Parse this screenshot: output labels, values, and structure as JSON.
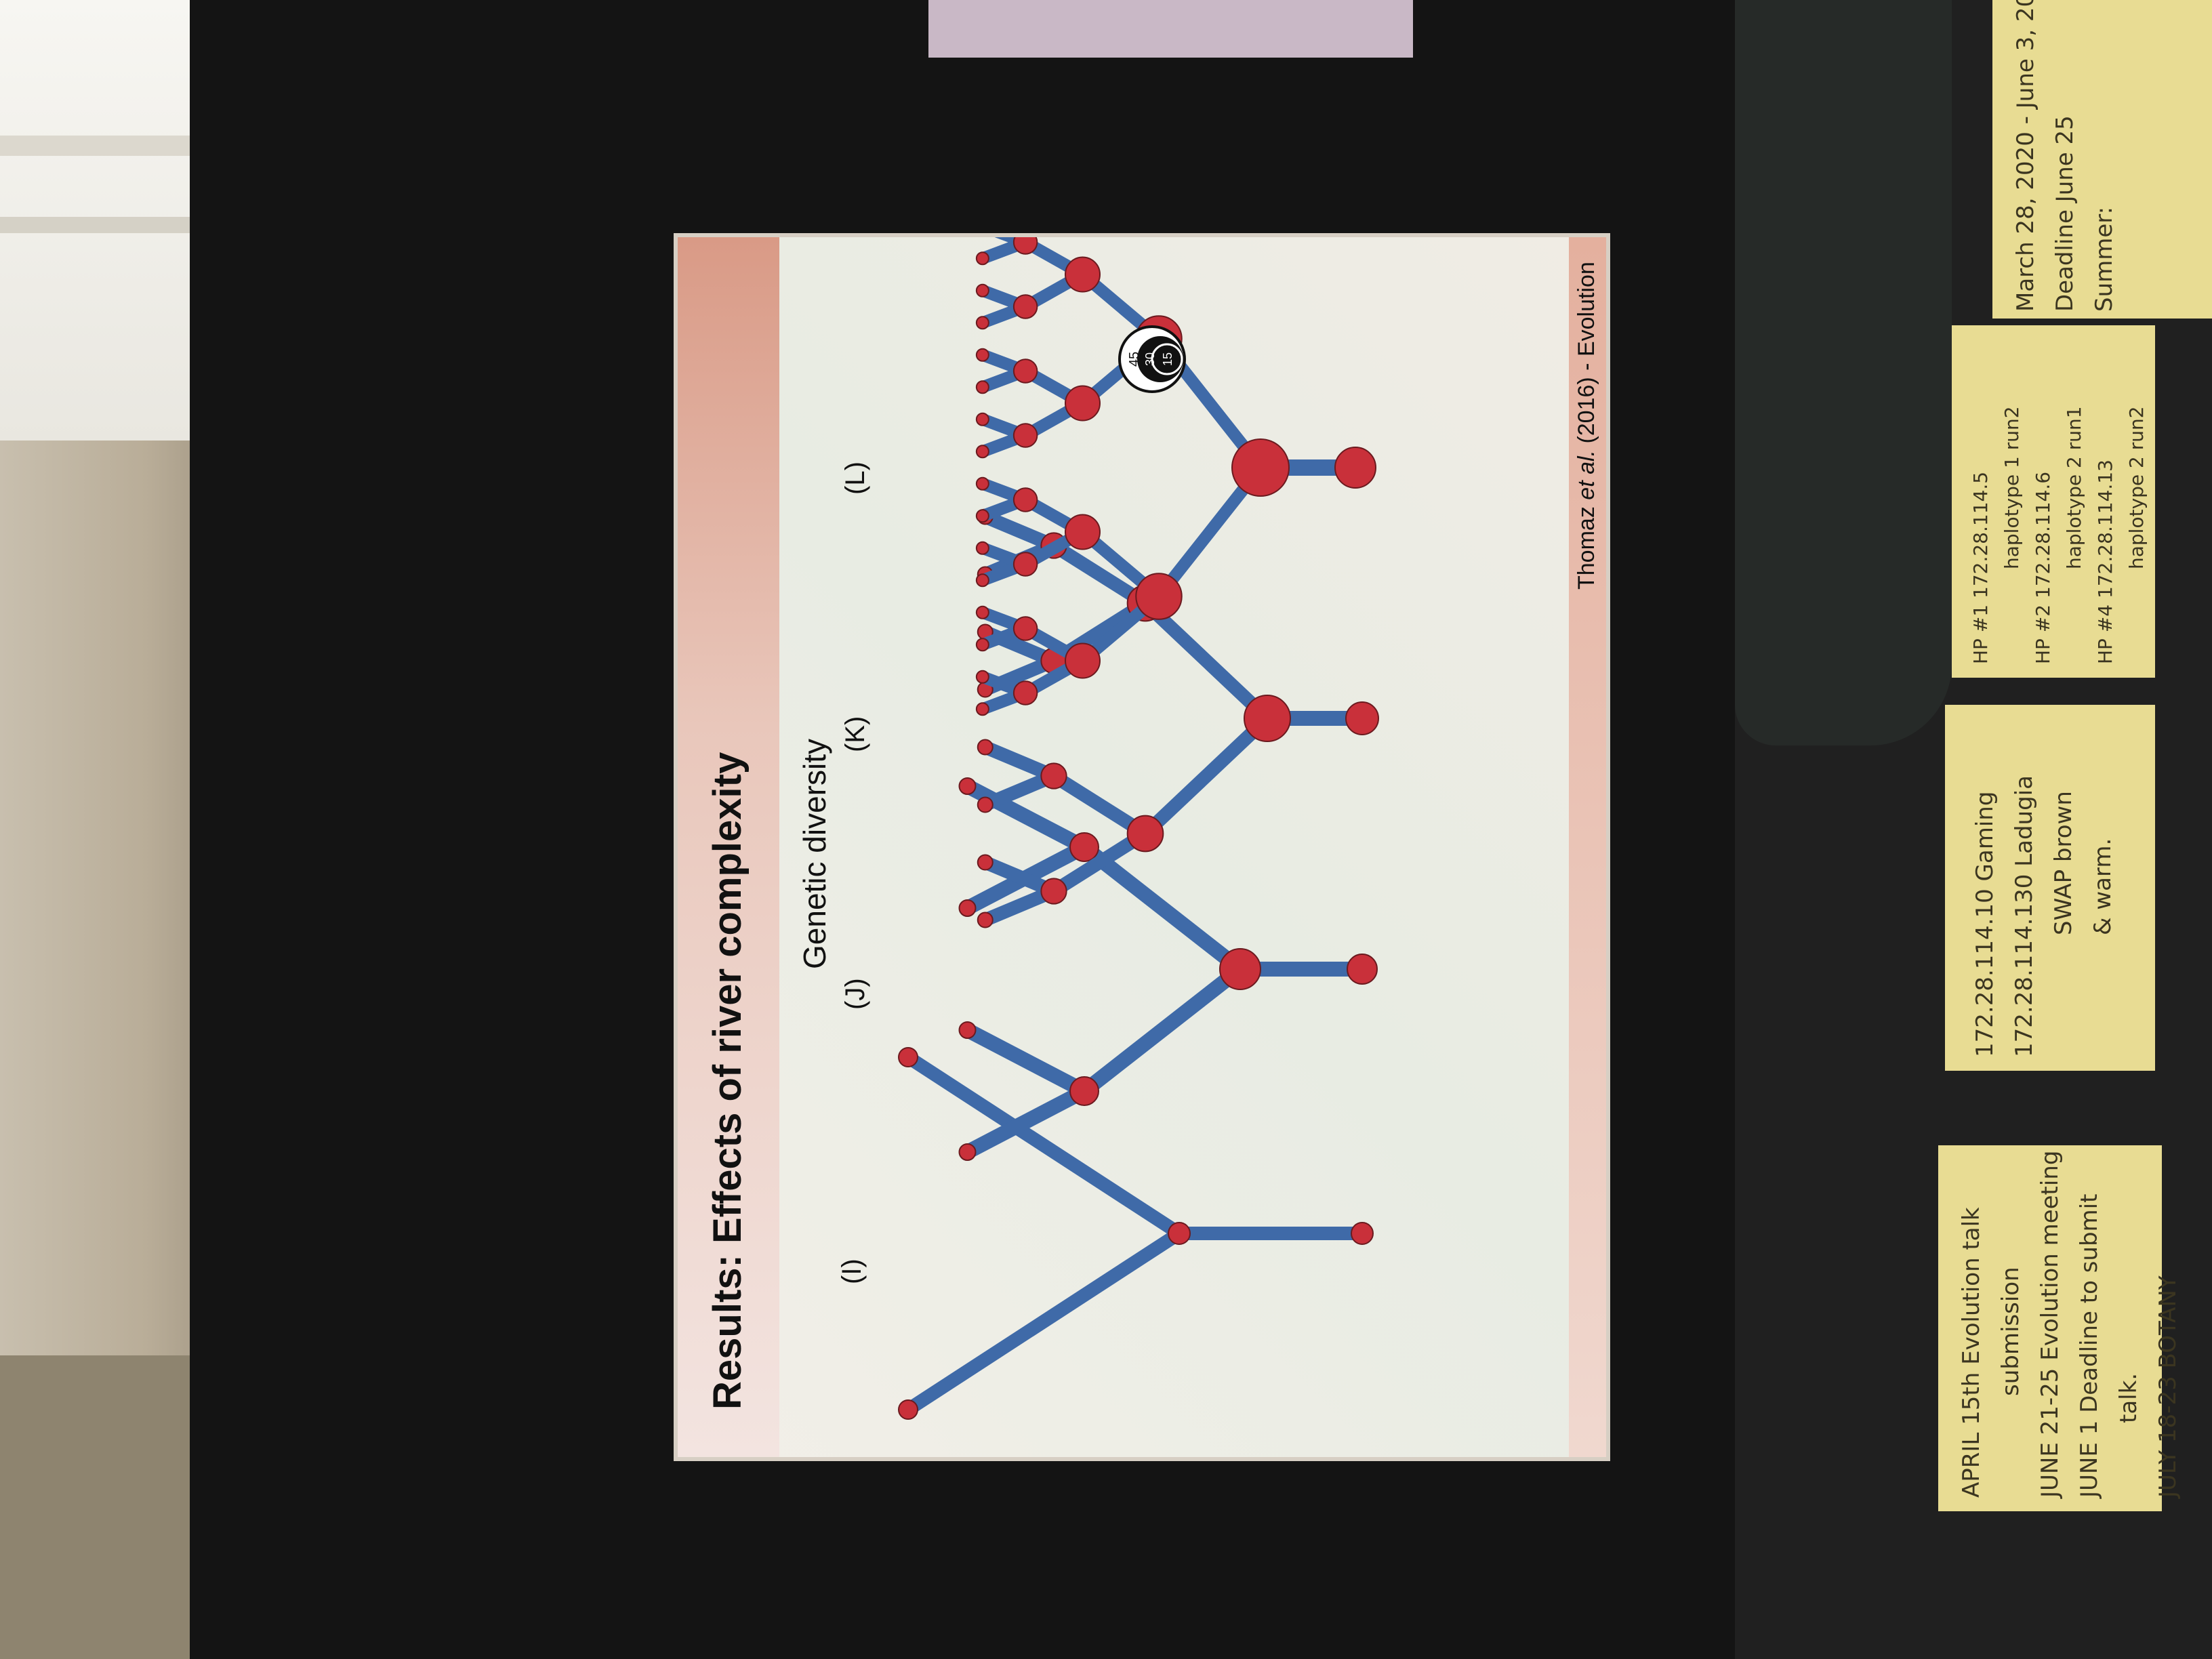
{
  "slide": {
    "title": "Results: Effects of river complexity",
    "subtitle": "Genetic diversity",
    "panels": [
      "(I)",
      "(J)",
      "(K)",
      "(L)"
    ],
    "legend_numbers": [
      "45",
      "30",
      "15"
    ],
    "citation_author": "Thomaz",
    "citation_etal": "et al.",
    "citation_rest": "(2016) - Evolution"
  },
  "notes": {
    "left": [
      "APRIL 15th  Evolution talk",
      "submission",
      "JUNE 21-25  Evolution meeting",
      "JUNE 1  Deadline to submit",
      "talk.",
      "JULY 18-23 BOTANY"
    ],
    "middle": [
      "172.28.114.10 Gaming",
      "172.28.114.130 Ladugia",
      "SWAP brown",
      "& warm."
    ],
    "middle_right": [
      "HP #1   172.28.114.5",
      "haplotype 1 run2",
      "HP #2   172.28.114.6",
      "haplotype 2 run1",
      "HP #4   172.28.114.13",
      "haplotype 2 run2"
    ],
    "right": [
      "March 28, 2020 - June 3, 20",
      "Deadline June 25",
      "Summer:"
    ]
  },
  "colors": {
    "branch": "#3f6aa8",
    "node": "#c9303a",
    "node_outline": "#6b1a1f",
    "sticky": "#e8dc93"
  }
}
